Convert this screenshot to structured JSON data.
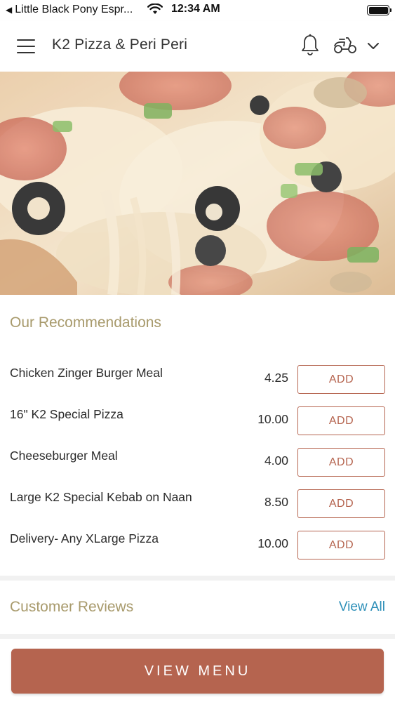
{
  "status_bar": {
    "back_glyph": "◀",
    "carrier": "Little Black Pony Espr...",
    "time": "12:34 AM",
    "icons": [
      "wifi-icon",
      "battery-icon"
    ]
  },
  "header": {
    "title": "K2 Pizza & Peri Peri",
    "icons": [
      "menu-icon",
      "bell-icon",
      "scooter-icon",
      "chevron-down-icon"
    ]
  },
  "recommendations": {
    "title": "Our Recommendations",
    "items": [
      {
        "name": "Chicken Zinger Burger Meal",
        "price": "4.25",
        "button": "ADD"
      },
      {
        "name": "16\" K2 Special Pizza",
        "price": "10.00",
        "button": "ADD"
      },
      {
        "name": "Cheeseburger Meal",
        "price": "4.00",
        "button": "ADD"
      },
      {
        "name": "Large K2 Special Kebab on Naan",
        "price": "8.50",
        "button": "ADD"
      },
      {
        "name": "Delivery- Any XLarge Pizza",
        "price": "10.00",
        "button": "ADD"
      }
    ]
  },
  "reviews": {
    "title": "Customer Reviews",
    "view_all": "View All"
  },
  "footer": {
    "view_menu": "VIEW MENU"
  },
  "colors": {
    "accent": "#b5644f",
    "section_title": "#a89a6c",
    "link": "#2d8fb8"
  }
}
